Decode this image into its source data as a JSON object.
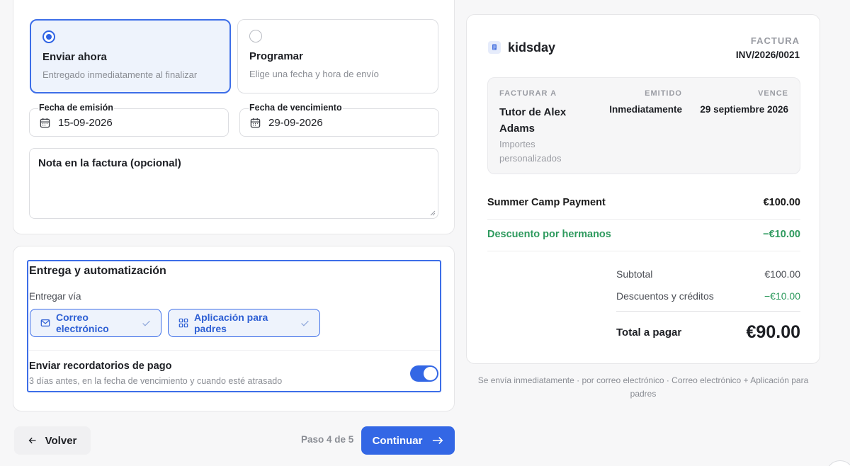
{
  "send_options": [
    {
      "title": "Enviar ahora",
      "desc": "Entregado inmediatamente al finalizar",
      "selected": true
    },
    {
      "title": "Programar",
      "desc": "Elige una fecha y hora de envío",
      "selected": false
    }
  ],
  "dates": {
    "issue_label": "Fecha de emisión",
    "issue_value": "15-09-2026",
    "due_label": "Fecha de vencimiento",
    "due_value": "29-09-2026"
  },
  "note_label": "Nota en la factura (opcional)",
  "delivery": {
    "title": "Entrega y automatización",
    "via_label": "Entregar vía",
    "channels": [
      "Correo electrónico",
      "Aplicación para padres"
    ],
    "reminders_title": "Enviar recordatorios de pago",
    "reminders_desc": "3 días antes, en la fecha de vencimiento y cuando esté atrasado",
    "reminders_on": true
  },
  "footer": {
    "back_label": "Volver",
    "step": "Paso 4 de 5",
    "next_label": "Continuar"
  },
  "invoice": {
    "brand": "kidsday",
    "label": "FACTURA",
    "number": "INV/2026/0021",
    "bill_to_head": "FACTURAR A",
    "bill_to_name": "Tutor de Alex Adams",
    "bill_to_sub": "Importes personalizados",
    "issued_head": "EMITIDO",
    "issued_val": "Inmediatamente",
    "due_head": "VENCE",
    "due_val": "29 septiembre 2026",
    "lines": [
      {
        "name": "Summer Camp Payment",
        "amount": "€100.00"
      },
      {
        "name": "Descuento por hermanos",
        "amount": "−€10.00"
      }
    ],
    "subtotal_label": "Subtotal",
    "subtotal": "€100.00",
    "discounts_label": "Descuentos y créditos",
    "discounts": "−€10.00",
    "total_label": "Total a pagar",
    "total": "€90.00"
  },
  "summary_note": "Se envía inmediatamente · por correo electrónico · Correo electrónico + Aplicación para padres",
  "colors": {
    "accent": "#3367e5",
    "green": "#2e9a5e"
  }
}
